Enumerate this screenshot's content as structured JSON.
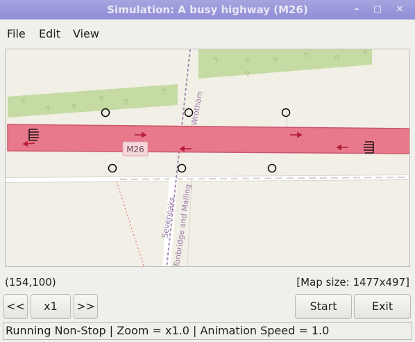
{
  "window": {
    "title": "Simulation: A busy highway (M26)",
    "minimize_glyph": "–",
    "maximize_glyph": "□",
    "close_glyph": "✕"
  },
  "menu": {
    "items": [
      "File",
      "Edit",
      "View"
    ]
  },
  "map": {
    "road_label": "M26",
    "street_labels": [
      "Wrotham",
      "Sevenoaks",
      "Tonbridge and Malling"
    ],
    "colors": {
      "background": "#f2efe6",
      "green_area": "#c6dba3",
      "highway_fill": "#e8798c",
      "highway_border": "#c9566c",
      "road_white": "#ffffff",
      "boundary": "#a58bb0"
    }
  },
  "status": {
    "coords": "(154,100)",
    "map_size": "[Map size: 1477x497]",
    "text": "Running Non-Stop | Zoom = x1.0 | Animation Speed = 1.0"
  },
  "controls": {
    "slower": "<<",
    "speed": "x1",
    "faster": ">>",
    "start": "Start",
    "exit": "Exit"
  }
}
